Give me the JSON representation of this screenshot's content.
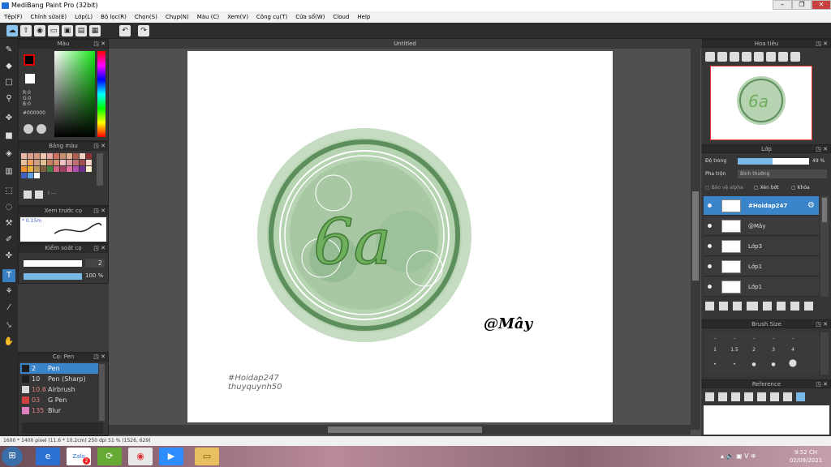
{
  "titlebar": {
    "title": "MediBang Paint Pro (32bit)"
  },
  "menu": [
    "Tệp(F)",
    "Chỉnh sửa(E)",
    "Lớp(L)",
    "Bộ lọc(R)",
    "Chọn(S)",
    "Chụp(N)",
    "Màu (C)",
    "Xem(V)",
    "Công cụ(T)",
    "Cửa sổ(W)",
    "Cloud",
    "Help"
  ],
  "color_panel": {
    "title": "Màu",
    "r": "R:0",
    "g": "G:0",
    "b": "B:0",
    "hex": "#000000",
    "fg": "#e00000",
    "bg": "#ffffff"
  },
  "palette_panel": {
    "title": "Bảng màu",
    "extra": "I ---"
  },
  "brush_preview_panel": {
    "title": "Xem trước cọ",
    "size_label": "* 0.15m"
  },
  "brush_control_panel": {
    "title": "Kiểm soát cọ",
    "size": "2",
    "opacity": "100 %"
  },
  "brush_list_panel": {
    "title": "Cọ: Pen",
    "items": [
      {
        "size": "2",
        "name": "Pen",
        "swatch": "#1e1e1e",
        "selected": true
      },
      {
        "size": "10",
        "name": "Pen (Sharp)",
        "swatch": "#1e1e1e",
        "selected": false
      },
      {
        "size": "10.8",
        "name": "Airbrush",
        "swatch": "#d8d8d8",
        "selected": false
      },
      {
        "size": "03",
        "name": "G Pen",
        "swatch": "#d04040",
        "selected": false
      },
      {
        "size": "135",
        "name": "Blur",
        "swatch": "#e080c0",
        "selected": false
      }
    ]
  },
  "canvas": {
    "tab": "Untitled",
    "watermark1": "@Mây",
    "watermark2": "#Hoidap247",
    "watermark3": "thuyquynh50"
  },
  "navigator": {
    "title": "Hoa tiêu"
  },
  "layer_panel": {
    "title": "Lớp",
    "opacity_label": "Độ trong",
    "opacity_value": "49 %",
    "opacity": 0.49,
    "blend_label": "Pha trộn",
    "blend_value": "Bình thường",
    "protect_alpha": "Bảo vệ alpha",
    "clipping": "Xén bớt",
    "lock": "Khóa",
    "layers": [
      {
        "name": "#Hoidap247",
        "selected": true
      },
      {
        "name": "@Mây",
        "selected": false
      },
      {
        "name": "Lớp3",
        "selected": false
      },
      {
        "name": "Lớp1",
        "selected": false
      },
      {
        "name": "Lớp1",
        "selected": false
      }
    ]
  },
  "brush_size_panel": {
    "title": "Brush Size",
    "row1": [
      "-",
      "-",
      "-",
      "-",
      "-"
    ],
    "row2": [
      "1",
      "1.5",
      "2",
      "3",
      "4"
    ]
  },
  "reference_panel": {
    "title": "Reference"
  },
  "status": {
    "text": "1600 * 1400 pixel  (11.6 * 10.2cm)  250 dpi  51 %  (1526, 629)"
  },
  "taskbar": {
    "time": "9:52 CH",
    "date": "02/09/2021",
    "zalo_badge": "2"
  }
}
